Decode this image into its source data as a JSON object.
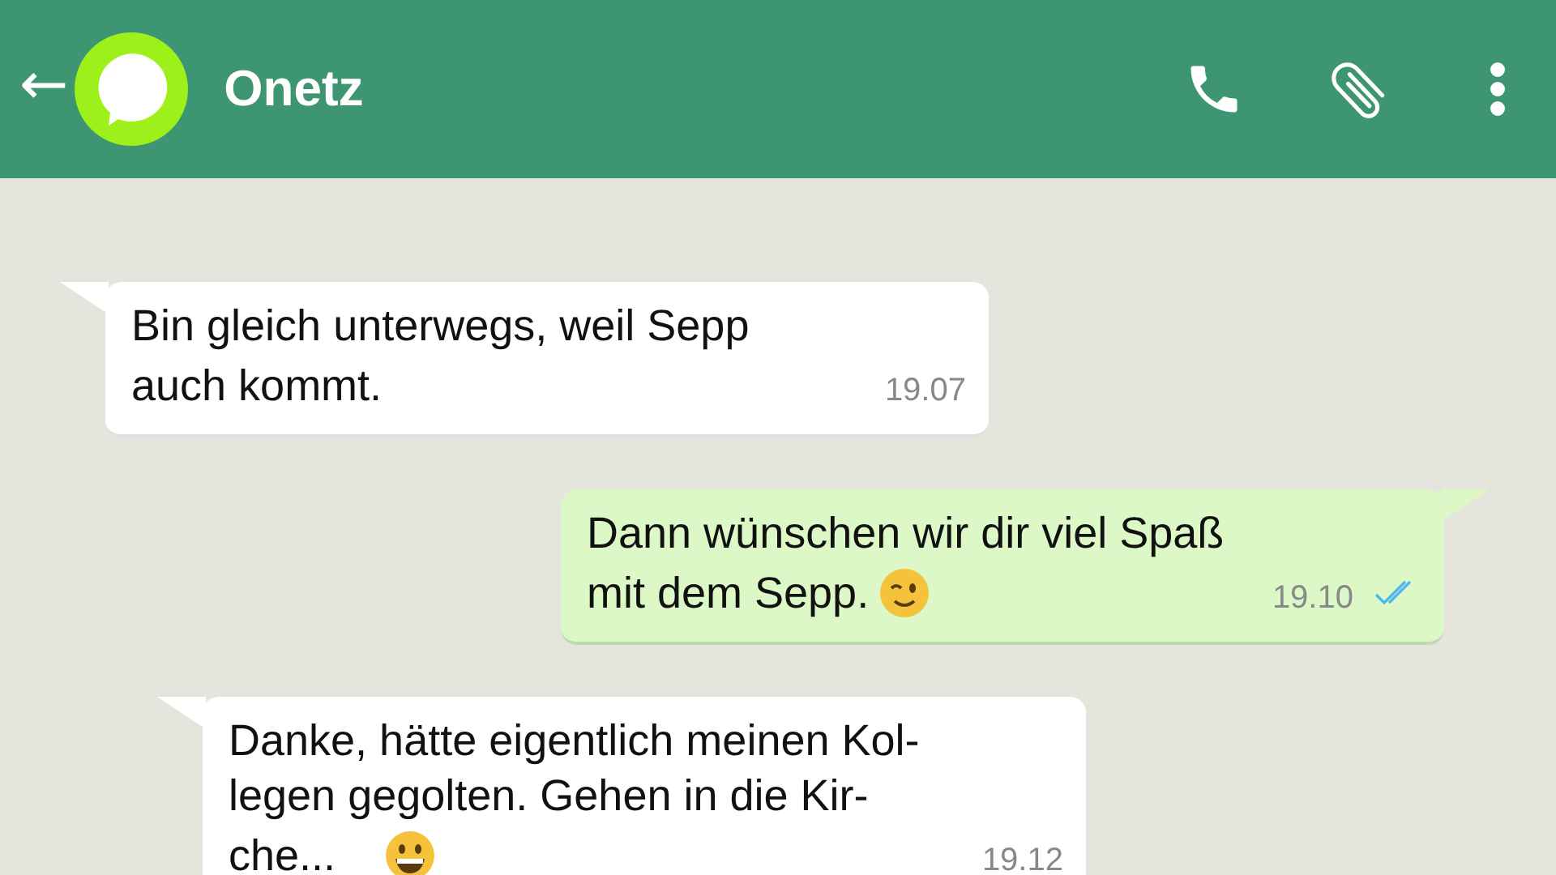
{
  "header": {
    "back": "←",
    "title": "Onetz"
  },
  "messages": [
    {
      "kind": "incoming",
      "lines": [
        "Bin gleich unterwegs, weil Sepp",
        "auch kommt."
      ],
      "time": "19.07"
    },
    {
      "kind": "outgoing",
      "lines": [
        "Dann wünschen wir dir viel Spaß",
        "mit dem Sepp."
      ],
      "emoji": {
        "kind": "wink"
      },
      "time": "19.10",
      "read": true
    },
    {
      "kind": "incoming",
      "lines": [
        "Danke, hätte eigentlich meinen Kol-",
        "legen gegolten. Gehen in die Kir-",
        "che..."
      ],
      "emoji": {
        "kind": "grin"
      },
      "time": "19.12"
    }
  ]
}
